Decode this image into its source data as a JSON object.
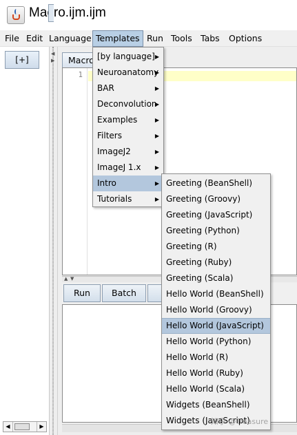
{
  "window": {
    "title": "Macro.ijm.ijm",
    "icon": "java-cup-icon"
  },
  "menubar": {
    "items": [
      {
        "label": "File"
      },
      {
        "label": "Edit"
      },
      {
        "label": "Language"
      },
      {
        "label": "Templates"
      },
      {
        "label": "Run"
      },
      {
        "label": "Tools"
      },
      {
        "label": "Tabs"
      },
      {
        "label": "Options"
      }
    ],
    "active": "Templates"
  },
  "left_panel": {
    "new_button_label": "[+]"
  },
  "editor": {
    "tab_label": "Macro",
    "line_numbers": [
      "1"
    ],
    "current_line_color": "#ffffc8"
  },
  "toolbar": {
    "run_label": "Run",
    "batch_label": "Batch"
  },
  "templates_menu": {
    "items": [
      {
        "label": "[by language]"
      },
      {
        "label": "Neuroanatomy"
      },
      {
        "label": "BAR"
      },
      {
        "label": "Deconvolution"
      },
      {
        "label": "Examples"
      },
      {
        "label": "Filters"
      },
      {
        "label": "ImageJ2"
      },
      {
        "label": "ImageJ 1.x"
      },
      {
        "label": "Intro"
      },
      {
        "label": "Tutorials"
      }
    ],
    "selected": "Intro",
    "submenu_arrow": "▶"
  },
  "intro_submenu": {
    "items": [
      {
        "label": "Greeting (BeanShell)"
      },
      {
        "label": "Greeting (Groovy)"
      },
      {
        "label": "Greeting (JavaScript)"
      },
      {
        "label": "Greeting (Python)"
      },
      {
        "label": "Greeting (R)"
      },
      {
        "label": "Greeting (Ruby)"
      },
      {
        "label": "Greeting (Scala)"
      },
      {
        "label": "Hello World (BeanShell)"
      },
      {
        "label": "Hello World (Groovy)"
      },
      {
        "label": "Hello World (JavaScript)"
      },
      {
        "label": "Hello World (Python)"
      },
      {
        "label": "Hello World (R)"
      },
      {
        "label": "Hello World (Ruby)"
      },
      {
        "label": "Hello World (Scala)"
      },
      {
        "label": "Widgets (BeanShell)"
      },
      {
        "label": "Widgets (JavaScript)"
      }
    ],
    "selected": "Hello World (JavaScript)"
  },
  "watermark": "知乎 @Treasure",
  "colors": {
    "menu_highlight": "#b3c7dd",
    "menu_background": "#f0f0f0"
  }
}
